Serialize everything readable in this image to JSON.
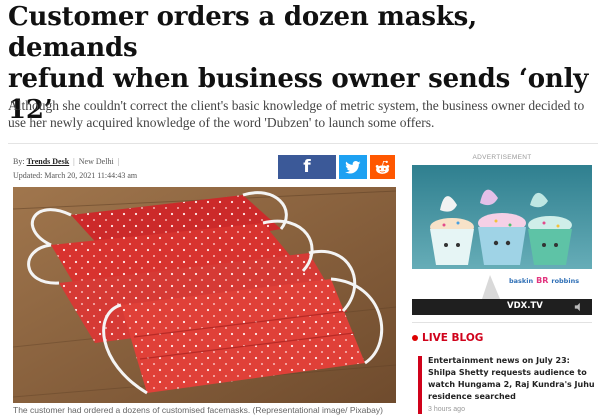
{
  "article": {
    "headline_line1": "Customer orders a dozen masks, demands",
    "headline_line2": "refund when business owner sends ‘only",
    "headline_line3": "12’",
    "subhead": "Although she couldn't correct the client's basic knowledge of metric system, the business owner decided to use her newly acquired knowledge of the word 'Dubzen' to launch some offers.",
    "byline_prefix": "By:",
    "author": "Trends Desk",
    "separator": "|",
    "location": "New Delhi",
    "updated": "Updated: March 20, 2021 11:44:43 am",
    "image_caption": "The customer had ordered a dozens of customised facemasks. (Representational image/ Pixabay)"
  },
  "share": {
    "facebook_glyph": "f",
    "icons": [
      "facebook-icon",
      "twitter-icon",
      "reddit-icon"
    ],
    "colors": {
      "facebook": "#3b5998",
      "twitter": "#1da1f2",
      "reddit": "#ff5700"
    }
  },
  "ad": {
    "label": "ADVERTISEMENT",
    "brand": "baskin",
    "brand_logo": "BR",
    "brand_suffix": "robbins",
    "player": "VDX.TV"
  },
  "live_blog": {
    "title": "LIVE BLOG",
    "headline": "Entertainment news on July 23: Shilpa Shetty requests audience to watch Hungama 2, Raj Kundra's Juhu residence searched",
    "time": "3 hours ago",
    "accent": "#d0021b"
  }
}
